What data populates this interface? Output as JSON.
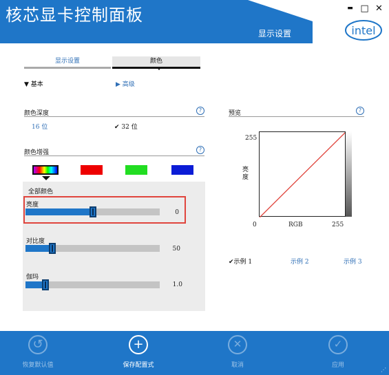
{
  "window": {
    "app_title": "核芯显卡控制面板",
    "section_title": "显示设置",
    "minimize_label": "▬",
    "maximize_label": "□",
    "close_label": "✕",
    "logo_text": "intel",
    "brand_color": "#1f76c8"
  },
  "tabs": {
    "display_settings": "显示设置",
    "color": "颜色"
  },
  "modes": {
    "basic": "▼ 基本",
    "advanced": "▶ 高级"
  },
  "color_depth": {
    "label": "颜色深度",
    "options": [
      "16 位",
      "✔ 32 位"
    ],
    "selected": "32 位",
    "help_icon": "question-icon"
  },
  "color_enhance": {
    "label": "颜色增强",
    "swatches": [
      "all",
      "red",
      "green",
      "blue"
    ],
    "selected_swatch": "all",
    "help_icon": "question-icon"
  },
  "adjust": {
    "group_label": "全部颜色",
    "brightness": {
      "label": "亮度",
      "value": "0",
      "level": 0.5
    },
    "contrast": {
      "label": "对比度",
      "value": "50",
      "level": 0.2
    },
    "gamma": {
      "label": "伽玛",
      "value": "1.0",
      "level": 0.15
    }
  },
  "preview": {
    "label": "预览",
    "y_max": "255",
    "x_min": "0",
    "x_label": "RGB",
    "x_max": "255",
    "y_label": "亮度",
    "help_icon": "question-icon"
  },
  "examples": [
    "✔示例 1",
    "示例 2",
    "示例 3"
  ],
  "actions": {
    "restore": {
      "label": "恢复默认值",
      "icon": "undo-icon"
    },
    "save": {
      "label": "保存配置式",
      "icon": "plus-icon"
    },
    "cancel": {
      "label": "取消",
      "icon": "close-icon"
    },
    "apply": {
      "label": "应用",
      "icon": "check-icon"
    }
  }
}
